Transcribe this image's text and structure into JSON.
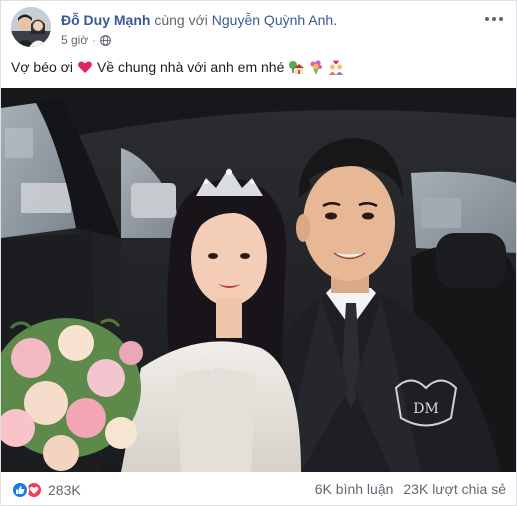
{
  "post": {
    "author": "Đỗ Duy Mạnh",
    "with_text": "cùng với",
    "tagged": "Nguyễn Quỳnh Anh.",
    "time": "5 giờ",
    "dot": "·",
    "privacy_icon": "globe-icon",
    "caption_part1": "Vợ béo ơi",
    "caption_part2": "Về chung nhà với anh em nhé",
    "caption_emojis": [
      "red-heart-icon",
      "house-with-garden-icon",
      "bouquet-icon",
      "couple-with-heart-icon"
    ]
  },
  "reactions": {
    "types": [
      "like-icon",
      "love-icon"
    ],
    "count": "283K"
  },
  "stats": {
    "comments": "6K bình luận",
    "shares": "23K lượt chia sẻ"
  },
  "colors": {
    "link": "#385898",
    "meta": "#616770",
    "like": "#1877f2",
    "love": "#f33e58"
  }
}
